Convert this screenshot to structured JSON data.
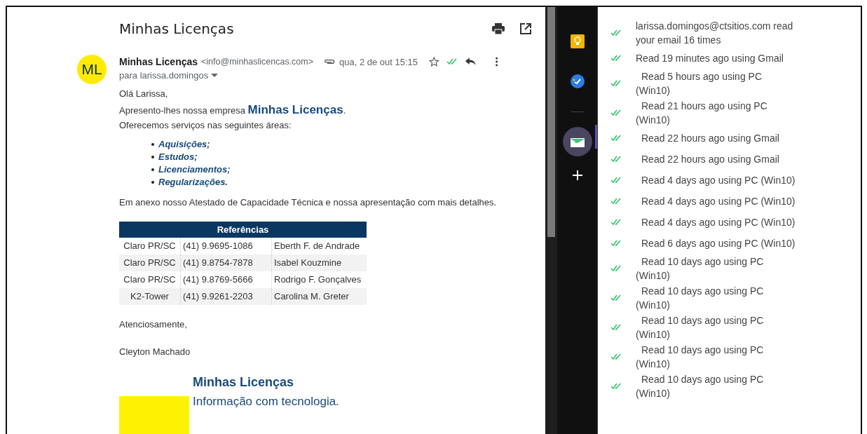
{
  "email": {
    "subject": "Minhas Licenças",
    "avatar": "ML",
    "sender_name": "Minhas Licenças",
    "sender_address": "<info@minhaslicencas.com>",
    "date": "qua, 2 de out 15:15",
    "recipient": "para larissa.domingos",
    "starred": false,
    "body": {
      "greeting": "Olá Larissa,",
      "intro": "Apresento-lhes nossa empresa",
      "company": "Minhas Licenças",
      "intro_end": ".",
      "services_intro": "Oferecemos serviços nas seguintes áreas:",
      "services": [
        "Aquisições;",
        "Estudos;",
        "Licenciamentos;",
        "Regularizações."
      ],
      "attachment_note": "Em anexo nosso Atestado de Capacidade Técnica e nossa apresentação com mais detalhes.",
      "table": {
        "title": "Referências",
        "rows": [
          [
            "Claro PR/SC",
            "(41) 9.9695-1086",
            "Eberth F. de Andrade"
          ],
          [
            "Claro PR/SC",
            "(41) 9.8754-7878",
            "Isabel Kouzmine"
          ],
          [
            "Claro PR/SC",
            "(41) 9.8769-5666",
            "Rodrigo F. Gonçalves"
          ],
          [
            "K2-Tower",
            "(41) 9.9261-2203",
            "Carolina M. Greter"
          ]
        ]
      },
      "closing": "Atenciosamente,",
      "signer": "Cleyton Machado",
      "signature": {
        "company": "Minhas Licenças",
        "tagline": "Informação com tecnologia."
      }
    }
  },
  "side_apps": [
    {
      "kind": "keep",
      "selected": false
    },
    {
      "kind": "tasks",
      "selected": false
    },
    {
      "kind": "divider",
      "selected": false
    },
    {
      "kind": "tracker",
      "selected": true
    },
    {
      "kind": "add",
      "selected": false
    }
  ],
  "read_log": [
    {
      "text": "larissa.domingos@ctsitios.com read your email 16 times",
      "indent": false
    },
    {
      "text": "Read 19 minutes ago using Gmail",
      "indent": false
    },
    {
      "text": "Read 5 hours ago using PC (Win10)",
      "indent": true
    },
    {
      "text": "Read 21 hours ago using PC (Win10)",
      "indent": true
    },
    {
      "text": "Read 22 hours ago using Gmail",
      "indent": true
    },
    {
      "text": "Read 22 hours ago using Gmail",
      "indent": true
    },
    {
      "text": "Read 4 days ago using PC (Win10)",
      "indent": true
    },
    {
      "text": "Read 4 days ago using PC (Win10)",
      "indent": true
    },
    {
      "text": "Read 4 days ago using PC (Win10)",
      "indent": true
    },
    {
      "text": "Read 6 days ago using PC (Win10)",
      "indent": true
    },
    {
      "text": "Read 10 days ago using PC (Win10)",
      "indent": true
    },
    {
      "text": "Read 10 days ago using PC (Win10)",
      "indent": true
    },
    {
      "text": "Read 10 days ago using PC (Win10)",
      "indent": true
    },
    {
      "text": "Read 10 days ago using PC (Win10)",
      "indent": true
    },
    {
      "text": "Read 10 days ago using PC (Win10)",
      "indent": true
    }
  ]
}
